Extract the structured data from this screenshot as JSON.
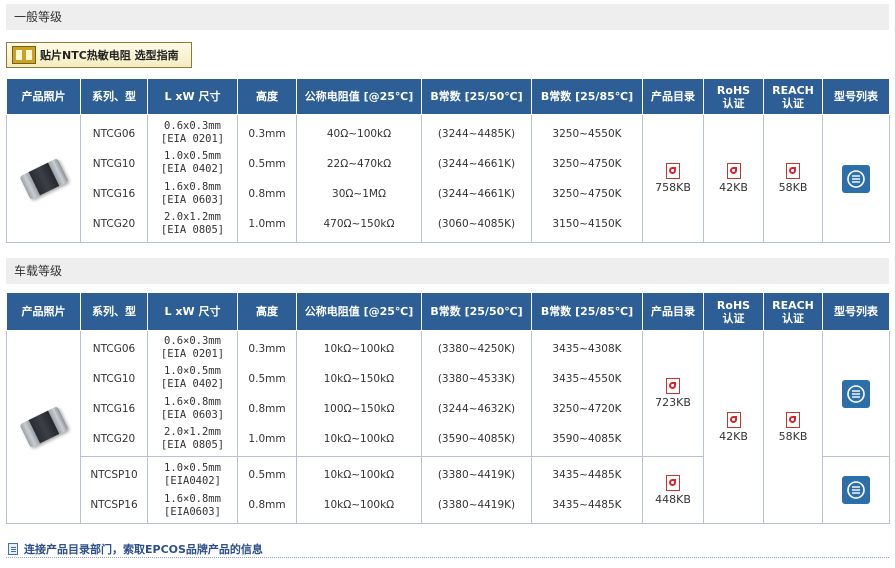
{
  "general": {
    "section_title": "一般等级",
    "guide_banner": "贴片NTC热敏电阻 选型指南",
    "headers": [
      "产品照片",
      "系列、型",
      "L xW 尺寸",
      "高度",
      "公称电阻值 [@25℃]",
      "B常数 [25/50℃]",
      "B常数 [25/85℃]",
      "产品目录",
      "RoHS\n认证",
      "REACH\n认证",
      "型号列表"
    ],
    "series": [
      "NTCG06",
      "NTCG10",
      "NTCG16",
      "NTCG20"
    ],
    "sizes": [
      {
        "dim": "0.6x0.3mm",
        "eia": "[EIA 0201]"
      },
      {
        "dim": "1.0x0.5mm",
        "eia": "[EIA 0402]"
      },
      {
        "dim": "1.6x0.8mm",
        "eia": "[EIA 0603]"
      },
      {
        "dim": "2.0x1.2mm",
        "eia": "[EIA 0805]"
      }
    ],
    "heights": [
      "0.3mm",
      "0.5mm",
      "0.8mm",
      "1.0mm"
    ],
    "resistance": [
      "40Ω~100kΩ",
      "22Ω~470kΩ",
      "30Ω~1MΩ",
      "470Ω~150kΩ"
    ],
    "b50": [
      "(3244~4485K)",
      "(3244~4661K)",
      "(3244~4661K)",
      "(3060~4085K)"
    ],
    "b85": [
      "3250~4550K",
      "3250~4750K",
      "3250~4750K",
      "3150~4150K"
    ],
    "catalog_size": "758KB",
    "rohs_size": "42KB",
    "reach_size": "58KB"
  },
  "automotive": {
    "section_title": "车载等级",
    "headers": [
      "产品照片",
      "系列、型",
      "L xW 尺寸",
      "高度",
      "公称电阻值 [@25℃]",
      "B常数 [25/50℃]",
      "B常数 [25/85℃]",
      "产品目录",
      "RoHS\n认证",
      "REACH\n认证",
      "型号列表"
    ],
    "series_a": [
      "NTCG06",
      "NTCG10",
      "NTCG16",
      "NTCG20"
    ],
    "sizes_a": [
      {
        "dim": "0.6×0.3mm",
        "eia": "[EIA 0201]"
      },
      {
        "dim": "1.0×0.5mm",
        "eia": "[EIA 0402]"
      },
      {
        "dim": "1.6×0.8mm",
        "eia": "[EIA 0603]"
      },
      {
        "dim": "2.0×1.2mm",
        "eia": "[EIA 0805]"
      }
    ],
    "heights_a": [
      "0.3mm",
      "0.5mm",
      "0.8mm",
      "1.0mm"
    ],
    "resistance_a": [
      "10kΩ~100kΩ",
      "10kΩ~150kΩ",
      "100Ω~150kΩ",
      "10kΩ~100kΩ"
    ],
    "b50_a": [
      "(3380~4250K)",
      "(3380~4533K)",
      "(3244~4632K)",
      "(3590~4085K)"
    ],
    "b85_a": [
      "3435~4308K",
      "3435~4550K",
      "3250~4720K",
      "3590~4085K"
    ],
    "catalog_size_a": "723KB",
    "series_b": [
      "NTCSP10",
      "NTCSP16"
    ],
    "sizes_b": [
      {
        "dim": "1.0×0.5mm",
        "eia": "[EIA0402]"
      },
      {
        "dim": "1.6×0.8mm",
        "eia": "[EIA0603]"
      }
    ],
    "heights_b": [
      "0.5mm",
      "0.8mm"
    ],
    "resistance_b": [
      "10kΩ~100kΩ",
      "10kΩ~100kΩ"
    ],
    "b50_b": [
      "(3380~4419K)",
      "(3380~4419K)"
    ],
    "b85_b": [
      "3435~4485K",
      "3435~4485K"
    ],
    "catalog_size_b": "448KB",
    "rohs_size": "42KB",
    "reach_size": "58KB"
  },
  "footer": {
    "link_text": "连接产品目录部门，索取EPCOS品牌产品的信息"
  },
  "colors": {
    "header_bg": "#2d5f96",
    "section_bg": "#eeeeee",
    "link": "#2d4f8a"
  },
  "icons": [
    "chip-photo-icon",
    "pdf-icon",
    "part-list-icon",
    "guide-book-icon",
    "document-icon"
  ]
}
